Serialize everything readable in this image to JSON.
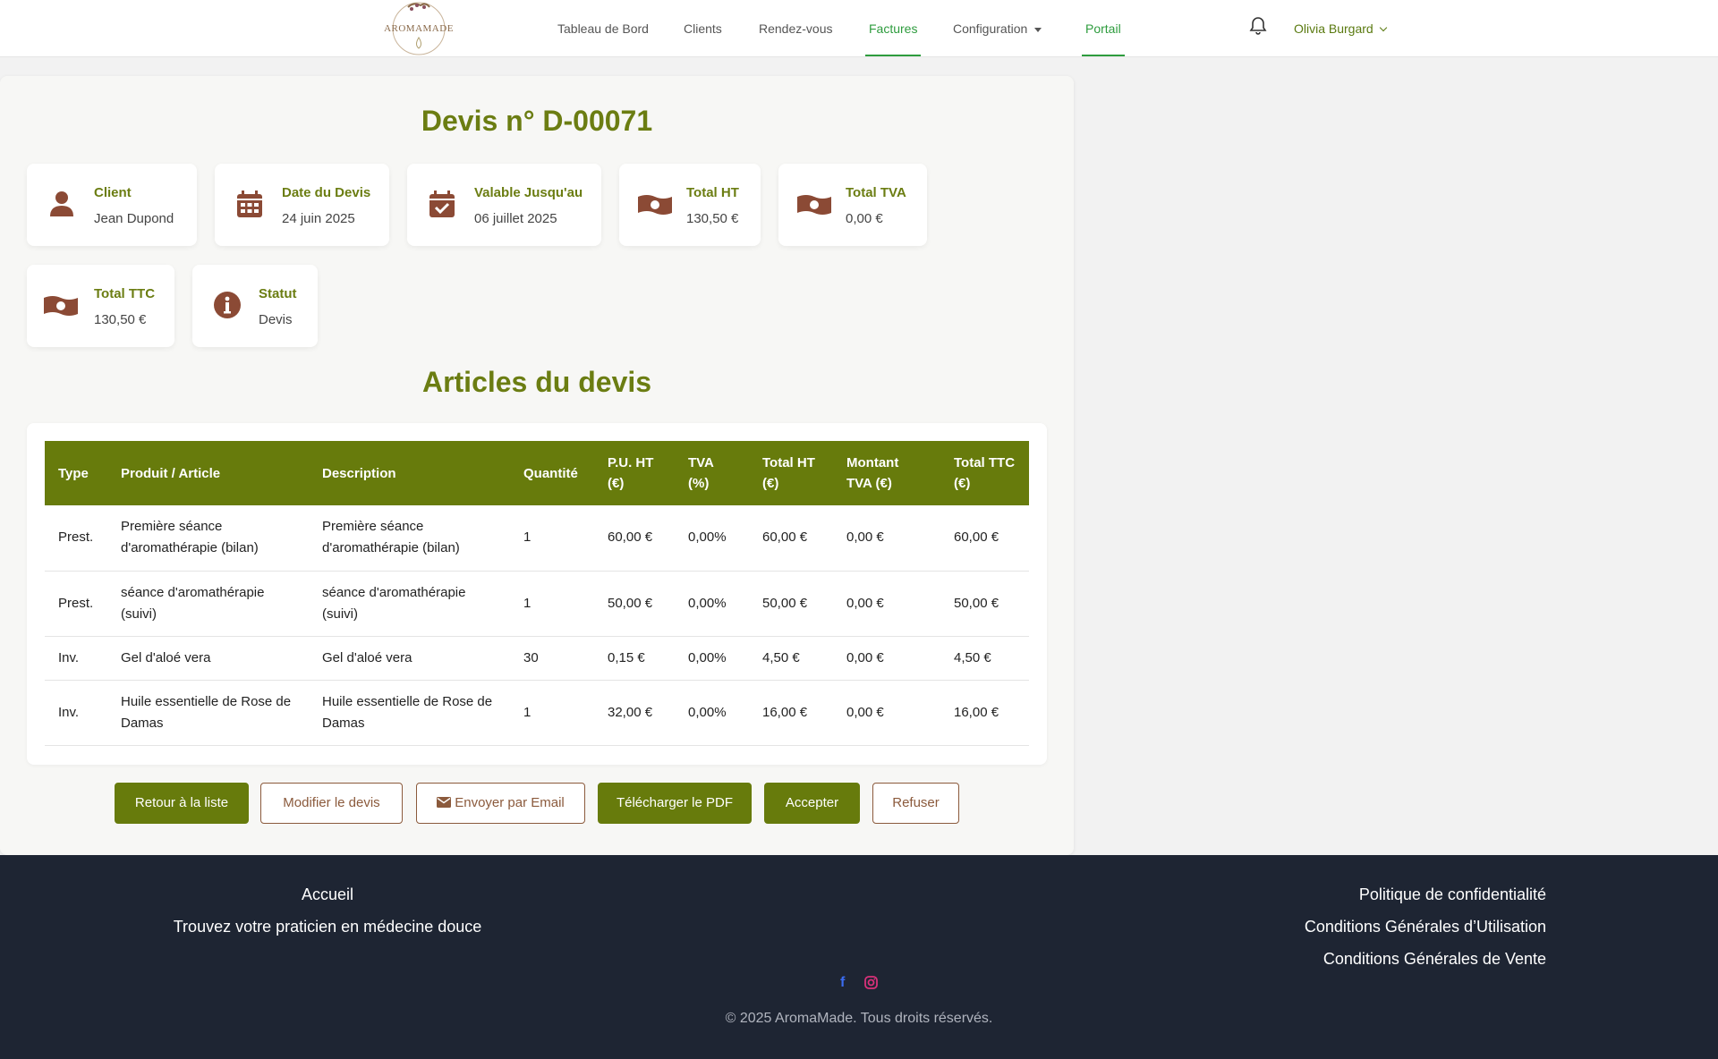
{
  "brand": {
    "logo_text": "AROMAMADE"
  },
  "nav": {
    "items": [
      {
        "label": "Tableau de Bord"
      },
      {
        "label": "Clients"
      },
      {
        "label": "Rendez-vous"
      },
      {
        "label": "Factures"
      },
      {
        "label": "Configuration"
      },
      {
        "label": "Portail"
      }
    ],
    "user_name": "Olivia Burgard"
  },
  "quote": {
    "title": "Devis n° D-00071",
    "cards": [
      {
        "label": "Client",
        "value": "Jean Dupond",
        "icon": "user-icon"
      },
      {
        "label": "Date du Devis",
        "value": "24 juin 2025",
        "icon": "calendar-icon"
      },
      {
        "label": "Valable Jusqu'au",
        "value": "06 juillet 2025",
        "icon": "calendar-check-icon"
      },
      {
        "label": "Total HT",
        "value": "130,50 €",
        "icon": "money-bill-icon"
      },
      {
        "label": "Total TVA",
        "value": "0,00 €",
        "icon": "money-bill-icon"
      },
      {
        "label": "Total TTC",
        "value": "130,50 €",
        "icon": "money-bill-icon"
      },
      {
        "label": "Statut",
        "value": "Devis",
        "icon": "info-circle-icon"
      }
    ],
    "items_title": "Articles du devis",
    "table": {
      "headers": [
        "Type",
        "Produit / Article",
        "Description",
        "Quantité",
        "P.U. HT (€)",
        "TVA (%)",
        "Total HT (€)",
        "Montant TVA (€)",
        "Total TTC (€)"
      ],
      "rows": [
        [
          "Prest.",
          "Première séance d'aromathérapie (bilan)",
          "Première séance d'aromathérapie (bilan)",
          "1",
          "60,00 €",
          "0,00%",
          "60,00 €",
          "0,00 €",
          "60,00 €"
        ],
        [
          "Prest.",
          "séance d'aromathérapie (suivi)",
          "séance d'aromathérapie (suivi)",
          "1",
          "50,00 €",
          "0,00%",
          "50,00 €",
          "0,00 €",
          "50,00 €"
        ],
        [
          "Inv.",
          "Gel d'aloé vera",
          "Gel d'aloé vera",
          "30",
          "0,15 €",
          "0,00%",
          "4,50 €",
          "0,00 €",
          "4,50 €"
        ],
        [
          "Inv.",
          "Huile essentielle de Rose de Damas",
          "Huile essentielle de Rose de Damas",
          "1",
          "32,00 €",
          "0,00%",
          "16,00 €",
          "0,00 €",
          "16,00 €"
        ]
      ]
    },
    "buttons": {
      "back": "Retour à la liste",
      "edit": "Modifier le devis",
      "email": "Envoyer par Email",
      "pdf": "Télécharger le PDF",
      "accept": "Accepter",
      "refuse": "Refuser"
    }
  },
  "footer": {
    "left_links": [
      "Accueil",
      "Trouvez votre praticien en médecine douce"
    ],
    "right_links": [
      "Politique de confidentialité",
      "Conditions Générales d’Utilisation",
      "Conditions Générales de Vente"
    ],
    "social": [
      {
        "name": "facebook-icon",
        "glyph": "f",
        "color": "#3b6cf0"
      },
      {
        "name": "instagram-icon",
        "glyph": "◎",
        "color": "#d9317a"
      }
    ],
    "copyright": "© 2025 AromaMade. Tous droits réservés."
  },
  "colors": {
    "primary": "#677b0c",
    "accent": "#2e9c3e",
    "brown": "#8b5a3c",
    "footer": "#1e2533"
  }
}
